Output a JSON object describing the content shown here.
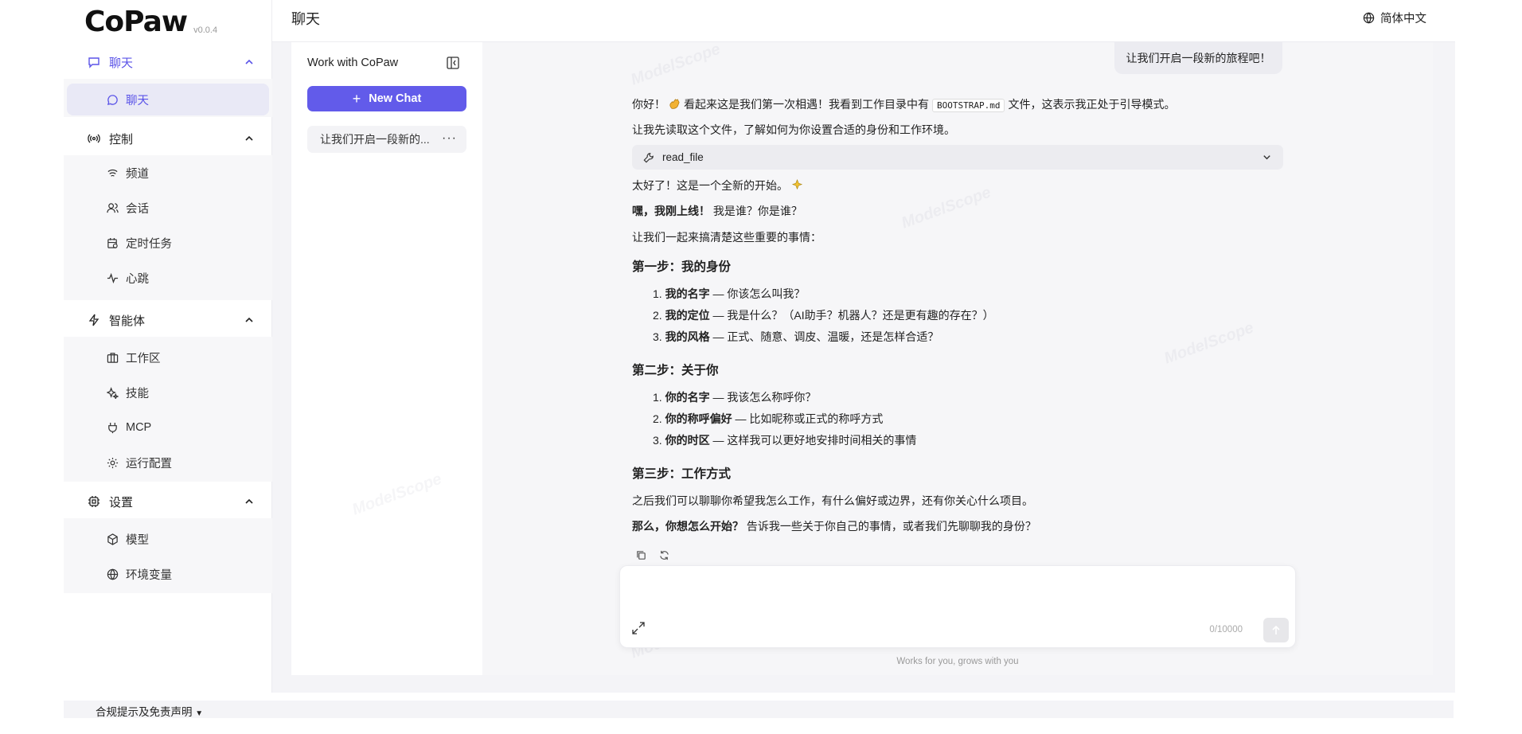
{
  "app": {
    "logo": "CoPaw",
    "version": "v0.0.4"
  },
  "header": {
    "title": "聊天",
    "language": "简体中文"
  },
  "sidebar": {
    "groups": [
      {
        "label": "聊天",
        "icon": "message-square-icon",
        "items": [
          {
            "label": "聊天",
            "icon": "chat-bubble-icon",
            "active": true
          }
        ]
      },
      {
        "label": "控制",
        "icon": "broadcast-icon",
        "items": [
          {
            "label": "频道",
            "icon": "wifi-icon"
          },
          {
            "label": "会话",
            "icon": "users-icon"
          },
          {
            "label": "定时任务",
            "icon": "calendar-clock-icon"
          },
          {
            "label": "心跳",
            "icon": "heartbeat-icon"
          }
        ]
      },
      {
        "label": "智能体",
        "icon": "zap-icon",
        "items": [
          {
            "label": "工作区",
            "icon": "briefcase-icon"
          },
          {
            "label": "技能",
            "icon": "sparkles-icon"
          },
          {
            "label": "MCP",
            "icon": "plug-icon"
          },
          {
            "label": "运行配置",
            "icon": "gear-icon"
          }
        ]
      },
      {
        "label": "设置",
        "icon": "cpu-icon",
        "items": [
          {
            "label": "模型",
            "icon": "cube-icon"
          },
          {
            "label": "环境变量",
            "icon": "globe-icon"
          }
        ]
      }
    ]
  },
  "chat_panel": {
    "title": "Work with CoPaw",
    "new_chat_label": "New Chat",
    "sessions": [
      {
        "title": "让我们开启一段新的..."
      }
    ]
  },
  "conversation": {
    "user_message": "让我们开启一段新的旅程吧！",
    "assistant": {
      "line1_a": "你好！",
      "line1_b": "看起来这是我们第一次相遇！我看到工作目录中有",
      "line1_code": "BOOTSTRAP.md",
      "line1_c": "文件，这表示我正处于引导模式。",
      "line2": "让我先读取这个文件，了解如何为你设置合适的身份和工作环境。",
      "tool_name": "read_file",
      "line3": "太好了！这是一个全新的开始。",
      "line4_bold": "嘿，我刚上线！",
      "line4_rest": " 我是谁？你是谁？",
      "line5": "让我们一起来搞清楚这些重要的事情：",
      "step1_title": "第一步：我的身份",
      "step1_items": [
        {
          "num": "1.",
          "bold": "我的名字",
          "rest": " — 你该怎么叫我？"
        },
        {
          "num": "2.",
          "bold": "我的定位",
          "rest": " — 我是什么？（AI助手？机器人？还是更有趣的存在？）"
        },
        {
          "num": "3.",
          "bold": "我的风格",
          "rest": " — 正式、随意、调皮、温暖，还是怎样合适？"
        }
      ],
      "step2_title": "第二步：关于你",
      "step2_items": [
        {
          "num": "1.",
          "bold": "你的名字",
          "rest": " — 我该怎么称呼你？"
        },
        {
          "num": "2.",
          "bold": "你的称呼偏好",
          "rest": " — 比如昵称或正式的称呼方式"
        },
        {
          "num": "3.",
          "bold": "你的时区",
          "rest": " — 这样我可以更好地安排时间相关的事情"
        }
      ],
      "step3_title": "第三步：工作方式",
      "line6": "之后我们可以聊聊你希望我怎么工作，有什么偏好或边界，还有你关心什么项目。",
      "line7_bold": "那么，你想怎么开始？",
      "line7_rest": " 告诉我一些关于你自己的事情，或者我们先聊聊我的身份？"
    }
  },
  "input": {
    "value": "",
    "placeholder": "",
    "char_count": "0/10000"
  },
  "footer": {
    "tagline": "Works for you, grows with you",
    "compliance": "合规提示及免责声明"
  },
  "watermark": "ModelScope",
  "colors": {
    "accent": "#625bea",
    "background": "#f4f4f7"
  }
}
